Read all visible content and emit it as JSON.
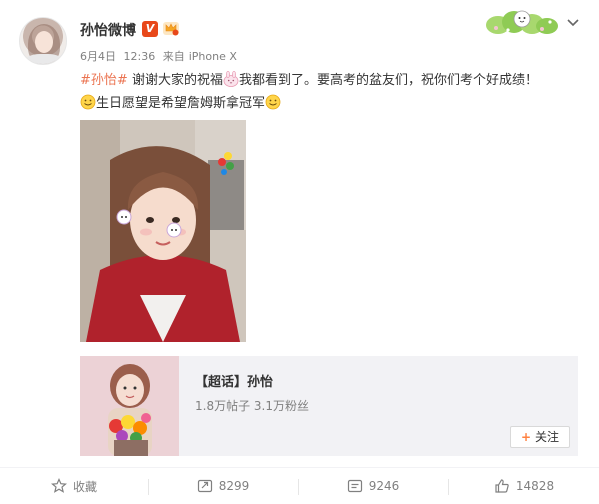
{
  "post": {
    "author": "孙怡微博",
    "verified_badge": "V",
    "date": "6月4日",
    "time": "12:36",
    "source_prefix": "来自",
    "source": "iPhone X",
    "topic": "#孙怡#",
    "text_part1": "谢谢大家的祝福",
    "text_part2": "我都看到了。要高考的盆友们，祝你们考个好成绩！",
    "text_line2": "生日愿望是希望詹姆斯拿冠军"
  },
  "supertopic": {
    "title": "【超话】孙怡",
    "posts": "1.8万帖子",
    "fans": "3.1万粉丝",
    "follow_label": "关注"
  },
  "actions": {
    "favorite_label": "收藏",
    "repost_count": "8299",
    "comment_count": "9246",
    "like_count": "14828"
  },
  "colors": {
    "topic": "#eb7350",
    "verified": "#e8481a",
    "follow_plus": "#ff8140"
  }
}
